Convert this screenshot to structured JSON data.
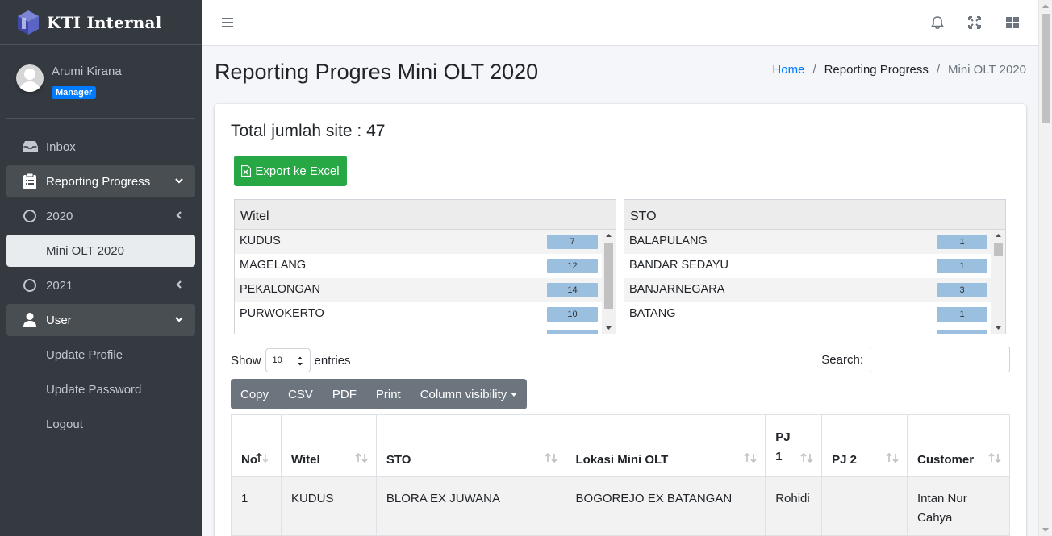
{
  "brand": {
    "name": "KTI Internal"
  },
  "user": {
    "name": "Arumi Kirana",
    "role": "Manager"
  },
  "sidebar": {
    "items": [
      {
        "label": "Inbox"
      },
      {
        "label": "Reporting Progress"
      },
      {
        "label": "2020"
      },
      {
        "label": "Mini OLT 2020"
      },
      {
        "label": "2021"
      },
      {
        "label": "User"
      },
      {
        "label": "Update Profile"
      },
      {
        "label": "Update Password"
      },
      {
        "label": "Logout"
      }
    ]
  },
  "header": {
    "title": "Reporting Progres Mini OLT 2020",
    "breadcrumb": [
      "Home",
      "/",
      "Reporting Progress",
      "/",
      "Mini OLT 2020"
    ]
  },
  "card": {
    "total_label": "Total jumlah site : 47",
    "export_label": "Export ke Excel"
  },
  "witel_list": {
    "title": "Witel",
    "rows": [
      {
        "label": "KUDUS",
        "count": "7"
      },
      {
        "label": "MAGELANG",
        "count": "12"
      },
      {
        "label": "PEKALONGAN",
        "count": "14"
      },
      {
        "label": "PURWOKERTO",
        "count": "10"
      }
    ]
  },
  "sto_list": {
    "title": "STO",
    "rows": [
      {
        "label": "BALAPULANG",
        "count": "1"
      },
      {
        "label": "BANDAR SEDAYU",
        "count": "1"
      },
      {
        "label": "BANJARNEGARA",
        "count": "3"
      },
      {
        "label": "BATANG",
        "count": "1"
      }
    ]
  },
  "datatable": {
    "show_label": "Show",
    "page_size": "10",
    "entries_label": "entries",
    "search_label": "Search:",
    "buttons": [
      "Copy",
      "CSV",
      "PDF",
      "Print",
      "Column visibility"
    ],
    "columns": [
      "No",
      "Witel",
      "STO",
      "Lokasi Mini OLT",
      "PJ 1",
      "PJ 2",
      "Customer"
    ],
    "rows": [
      [
        "1",
        "KUDUS",
        "BLORA EX JUWANA",
        "BOGOREJO EX BATANGAN",
        "Rohidi",
        "",
        "Intan Nur Cahya"
      ]
    ]
  },
  "colors": {
    "sidebar_bg": "#343a40",
    "accent": "#007bff",
    "success": "#28a745",
    "button_group": "#6c757d",
    "count_badge": "#9abfdf"
  }
}
